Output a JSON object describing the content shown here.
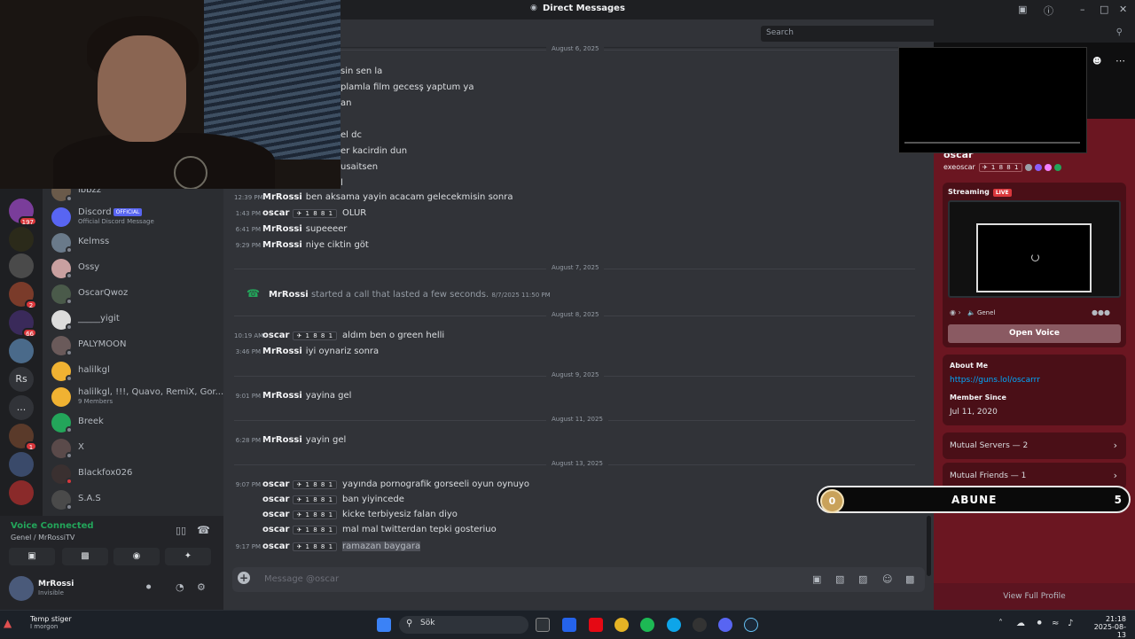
{
  "window": {
    "title": "Direct Messages"
  },
  "header": {
    "search_placeholder": "Search"
  },
  "rail": {
    "badges": [
      "197",
      "2",
      "66",
      "1"
    ],
    "text_servers": [
      "Rs",
      "..."
    ]
  },
  "dm_list": [
    {
      "name": "ibbzz",
      "sub": ""
    },
    {
      "name": "Discord",
      "badge": "OFFICIAL",
      "sub": "Official Discord Message"
    },
    {
      "name": "Kelmss",
      "sub": ""
    },
    {
      "name": "Ossy",
      "sub": ""
    },
    {
      "name": "OscarQwoz",
      "sub": ""
    },
    {
      "name": "_____yigit",
      "sub": ""
    },
    {
      "name": "PALYMOON",
      "sub": ""
    },
    {
      "name": "halilkgl",
      "sub": ""
    },
    {
      "name": "halilkgl, !!!, Quavo, RemiX, Gor...",
      "sub": "9 Members"
    },
    {
      "name": "Breek",
      "sub": ""
    },
    {
      "name": "X",
      "sub": ""
    },
    {
      "name": "Blackfox026",
      "sub": ""
    },
    {
      "name": "S.A.S",
      "sub": ""
    }
  ],
  "voice": {
    "status": "Voice Connected",
    "channel": "Genel / MrRossiTV",
    "user": "MrRossi",
    "user_status": "Invisible"
  },
  "chat": {
    "partial_lines": [
      "sin sen la",
      "plamla film gecesş yaptum ya",
      "an",
      "el dc",
      "er kacirdin dun",
      "usaitsen",
      "l"
    ],
    "dates": [
      "August 6, 2025",
      "August 7, 2025",
      "August 8, 2025",
      "August 9, 2025",
      "August 11, 2025",
      "August 13, 2025"
    ],
    "tag": "✈ 1 8 8 1",
    "messages": [
      {
        "ts": "12:39 PM",
        "author": "MrRossi",
        "text": "ben aksama yayin acacam gelecekmisin sonra"
      },
      {
        "ts": "1:43 PM",
        "author": "oscar",
        "tagged": true,
        "text": "OLUR"
      },
      {
        "ts": "6:41 PM",
        "author": "MrRossi",
        "text": "supeeeer"
      },
      {
        "ts": "9:29 PM",
        "author": "MrRossi",
        "text": "niye ciktin göt"
      },
      {
        "ts": "10:19 AM",
        "author": "oscar",
        "tagged": true,
        "text": "aldım ben o green helli"
      },
      {
        "ts": "3:46 PM",
        "author": "MrRossi",
        "text": "iyi oynariz sonra"
      },
      {
        "ts": "9:01 PM",
        "author": "MrRossi",
        "text": "yayina gel"
      },
      {
        "ts": "6:28 PM",
        "author": "MrRossi",
        "text": "yayin gel"
      },
      {
        "ts": "9:07 PM",
        "author": "oscar",
        "tagged": true,
        "text": "yayında pornografik gorseeli oyun oynuyo"
      },
      {
        "ts": "",
        "author": "oscar",
        "tagged": true,
        "text": "ban yiyincede"
      },
      {
        "ts": "",
        "author": "oscar",
        "tagged": true,
        "text": "kicke terbiyesiz falan diyo"
      },
      {
        "ts": "",
        "author": "oscar",
        "tagged": true,
        "text": "mal mal twitterdan tepki gosteriuo"
      },
      {
        "ts": "9:17 PM",
        "author": "oscar",
        "tagged": true,
        "text": "ramazan baygara"
      }
    ],
    "call": {
      "author": "MrRossi",
      "text": "started a call that lasted a few seconds.",
      "ts": "8/7/2025 11:50 PM"
    },
    "composer_placeholder": "Message @oscar"
  },
  "profile": {
    "name": "oscar",
    "handle": "exeoscar",
    "tag": "✈ 1 8 8 1",
    "streaming_label": "Streaming",
    "live_label": "LIVE",
    "channel": "Genel",
    "open_voice": "Open Voice",
    "about_title": "About Me",
    "about_link": "https://guns.lol/oscarrr",
    "member_since_title": "Member Since",
    "member_since": "Jul 11, 2020",
    "mutual_servers": "Mutual Servers — 2",
    "mutual_friends": "Mutual Friends — 1",
    "view_full": "View Full Profile"
  },
  "overlay": {
    "sub_count": "0",
    "sub_label": "ABUNE",
    "sub_goal": "5"
  },
  "taskbar": {
    "weather": "Temp stiger",
    "weather_sub": "I morgon",
    "search": "Sök",
    "time": "21:18",
    "date": "2025-08-13"
  }
}
